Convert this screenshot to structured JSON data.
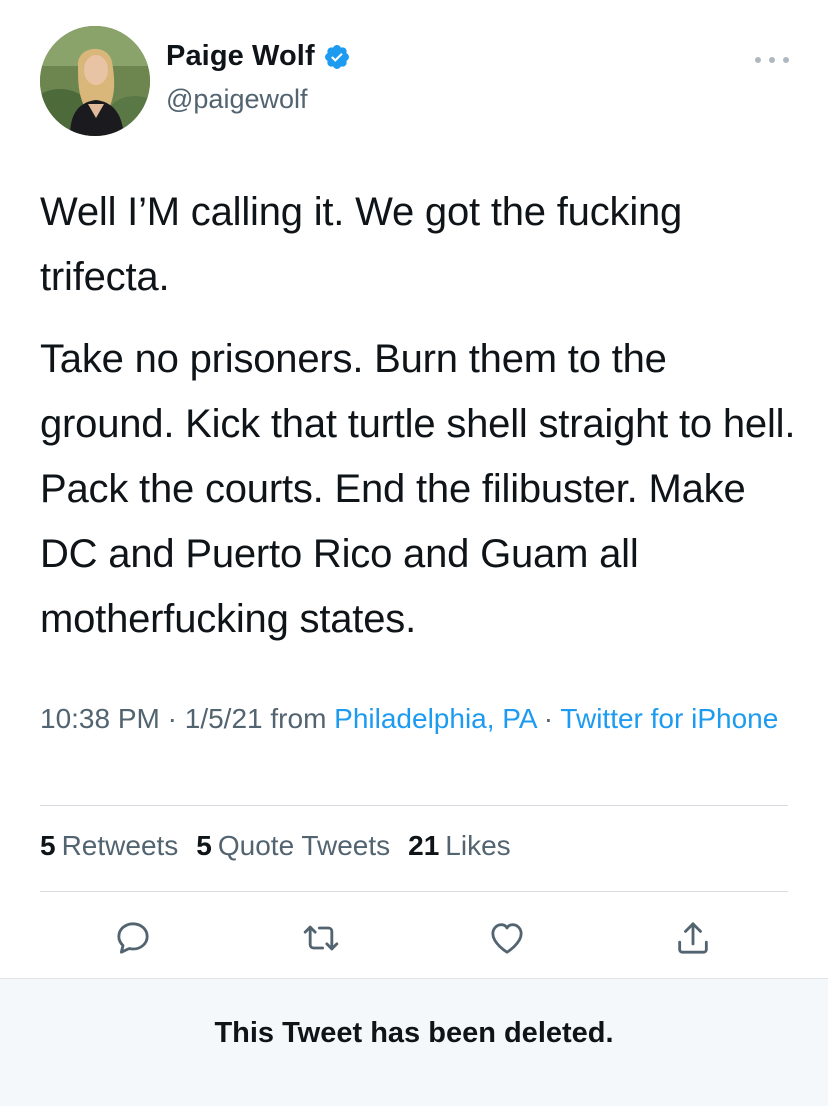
{
  "user": {
    "display_name": "Paige Wolf",
    "handle": "@paigewolf",
    "verified": true
  },
  "tweet": {
    "paragraph_1": "Well I’M calling it. We got the fucking trifecta.",
    "paragraph_2": "Take no prisoners. Burn them to the ground. Kick that turtle shell straight to hell. Pack the courts. End the filibuster. Make DC and Puerto Rico and Guam all motherfucking states."
  },
  "meta": {
    "time": "10:38 PM",
    "sep1": " · ",
    "date": "1/5/21",
    "from_label": " from ",
    "location": "Philadelphia, PA",
    "sep2": " · ",
    "client": "Twitter for iPhone"
  },
  "stats": {
    "retweets_count": "5",
    "retweets_label": "Retweets",
    "quotes_count": "5",
    "quotes_label": "Quote Tweets",
    "likes_count": "21",
    "likes_label": "Likes"
  },
  "icons": {
    "reply": "reply-icon",
    "retweet": "retweet-icon",
    "like": "heart-icon",
    "share": "share-icon",
    "more": "more-icon",
    "verified": "verified-badge-icon"
  },
  "colors": {
    "accent": "#1d9bf0",
    "text_primary": "#0f1419",
    "text_secondary": "#536471",
    "deleted_bar_bg": "#f5f8fa"
  },
  "deleted_notice": "This Tweet has been deleted."
}
